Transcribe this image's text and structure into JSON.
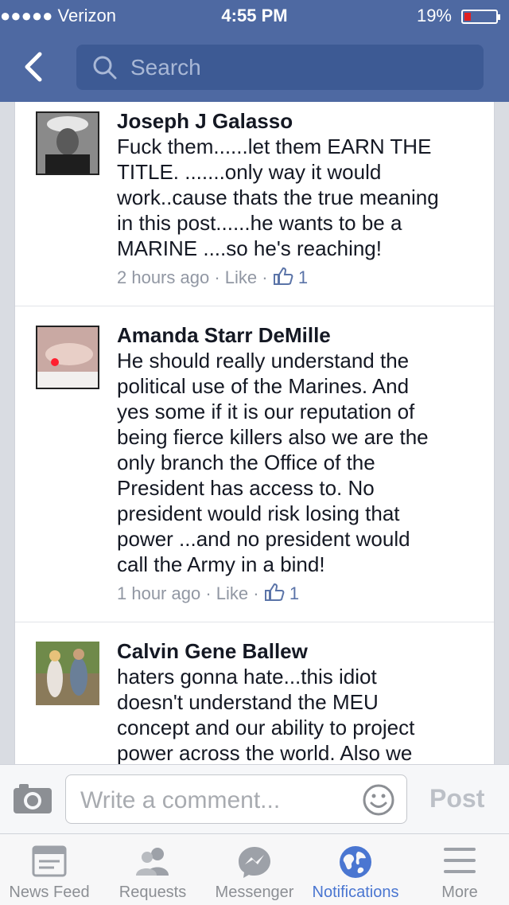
{
  "status_bar": {
    "carrier": "●●●●● Verizon",
    "time": "4:55 PM",
    "battery": "19%"
  },
  "search": {
    "placeholder": "Search"
  },
  "comments": [
    {
      "name": "Joseph J Galasso",
      "lines": [
        "Fuck them......let them EARN THE",
        "TITLE. .......only way it would",
        "work..cause thats the true meaning",
        "in this post......he wants to be a",
        "MARINE ....so he's  reaching!"
      ],
      "time": "2 hours ago",
      "like": "Like",
      "likes": "1"
    },
    {
      "name": "Amanda Starr DeMille",
      "lines": [
        "He should really understand the",
        "political use of the Marines. And",
        "yes some if it is our reputation of",
        "being fierce killers also we are the",
        "only branch the Office of the",
        "President has access to. No",
        "president would risk losing that",
        "power ...and no president would",
        "call the Army in a bind!"
      ],
      "time": "1 hour ago",
      "like": "Like",
      "likes": "1"
    },
    {
      "name": "Calvin Gene Ballew",
      "lines": [
        "haters gonna hate...this idiot",
        "doesn't understand the MEU",
        "concept and our ability to project",
        "power across the world. Also we"
      ]
    }
  ],
  "composer": {
    "placeholder": "Write a comment...",
    "post_label": "Post"
  },
  "tabs": [
    {
      "label": "News Feed",
      "icon": "news-feed-icon"
    },
    {
      "label": "Requests",
      "icon": "requests-icon"
    },
    {
      "label": "Messenger",
      "icon": "messenger-icon"
    },
    {
      "label": "Notifications",
      "icon": "globe-icon"
    },
    {
      "label": "More",
      "icon": "menu-icon"
    }
  ],
  "colors": {
    "header": "#4e69a2",
    "active_tab": "#4a76d1"
  }
}
